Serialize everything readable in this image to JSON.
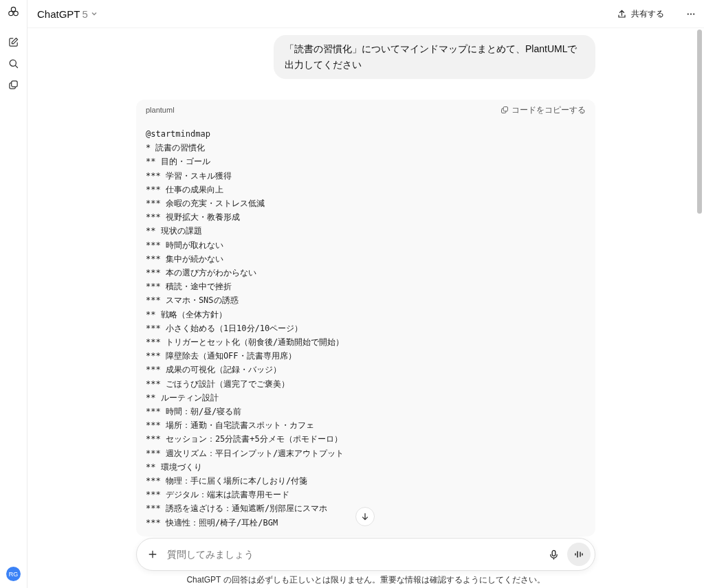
{
  "header": {
    "model": "ChatGPT",
    "version": "5",
    "share": "共有する"
  },
  "user_message": "「読書の習慣化」についてマインドマップにまとめて、PlantUMLで出力してください",
  "code_block": {
    "language": "plantuml",
    "copy": "コードをコピーする",
    "lines": [
      "@startmindmap",
      "* 読書の習慣化",
      "** 目的・ゴール",
      "*** 学習・スキル獲得",
      "*** 仕事の成果向上",
      "*** 余暇の充実・ストレス低減",
      "*** 視野拡大・教養形成",
      "** 現状の課題",
      "*** 時間が取れない",
      "*** 集中が続かない",
      "*** 本の選び方がわからない",
      "*** 積読・途中で挫折",
      "*** スマホ・SNSの誘惑",
      "** 戦略（全体方針）",
      "*** 小さく始める（1日10分/10ページ）",
      "*** トリガーとセット化（朝食後/通勤開始で開始）",
      "*** 障壁除去（通知OFF・読書専用席）",
      "*** 成果の可視化（記録・バッジ）",
      "*** ごほうび設計（週完了でご褒美）",
      "** ルーティン設計",
      "*** 時間：朝/昼/寝る前",
      "*** 場所：通勤・自宅読書スポット・カフェ",
      "*** セッション：25分読書+5分メモ（ポモドーロ）",
      "*** 週次リズム：平日インプット/週末アウトプット",
      "** 環境づくり",
      "*** 物理：手に届く場所に本/しおり/付箋",
      "*** デジタル：端末は読書専用モード",
      "*** 誘惑を遠ざける：通知遮断/別部屋にスマホ",
      "*** 快適性：照明/椅子/耳栓/BGM"
    ]
  },
  "composer": {
    "placeholder": "質問してみましょう"
  },
  "avatar": "RG",
  "disclaimer": "ChatGPT の回答は必ずしも正しいとは限りません。重要な情報は確認するようにしてください。"
}
